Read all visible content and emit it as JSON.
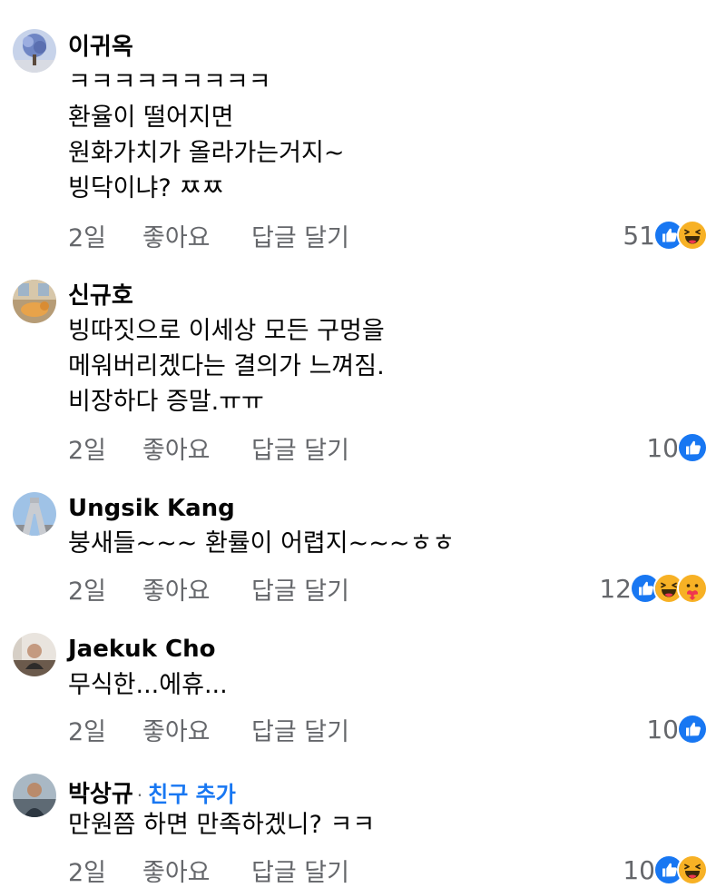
{
  "colors": {
    "link": "#1877f2",
    "secondary_text": "#65676b",
    "like_blue": "#1877f2",
    "emoji_yellow": "#f7b125"
  },
  "comments": [
    {
      "author": "이귀옥",
      "lines": [
        "ㅋㅋㅋㅋㅋㅋㅋㅋㅋ",
        "환율이 떨어지면",
        "원화가치가 올라가는거지~",
        "빙닥이냐? ㅉㅉ"
      ],
      "time": "2일",
      "like_label": "좋아요",
      "reply_label": "답글 달기",
      "reaction_count": "51",
      "reactions": [
        "like-icon",
        "haha-icon"
      ]
    },
    {
      "author": "신규호",
      "lines": [
        "빙따짓으로 이세상 모든 구멍을",
        "메워버리겠다는 결의가 느껴짐.",
        "비장하다 증말.ㅠㅠ"
      ],
      "time": "2일",
      "like_label": "좋아요",
      "reply_label": "답글 달기",
      "reaction_count": "10",
      "reactions": [
        "like-icon"
      ]
    },
    {
      "author": "Ungsik Kang",
      "lines": [
        "붕새들~~~ 환률이 어렵지~~~ㅎㅎ"
      ],
      "time": "2일",
      "like_label": "좋아요",
      "reply_label": "답글 달기",
      "reaction_count": "12",
      "reactions": [
        "like-icon",
        "haha-icon",
        "care-icon"
      ]
    },
    {
      "author": "Jaekuk Cho",
      "lines": [
        "무식한...에휴..."
      ],
      "time": "2일",
      "like_label": "좋아요",
      "reply_label": "답글 달기",
      "reaction_count": "10",
      "reactions": [
        "like-icon"
      ]
    },
    {
      "author": "박상규",
      "separator": "·",
      "add_friend_label": "친구 추가",
      "lines": [
        "만원쯤 하면 만족하겠니? ㅋㅋ"
      ],
      "time": "2일",
      "like_label": "좋아요",
      "reply_label": "답글 달기",
      "reaction_count": "10",
      "reactions": [
        "like-icon",
        "haha-icon"
      ]
    }
  ]
}
